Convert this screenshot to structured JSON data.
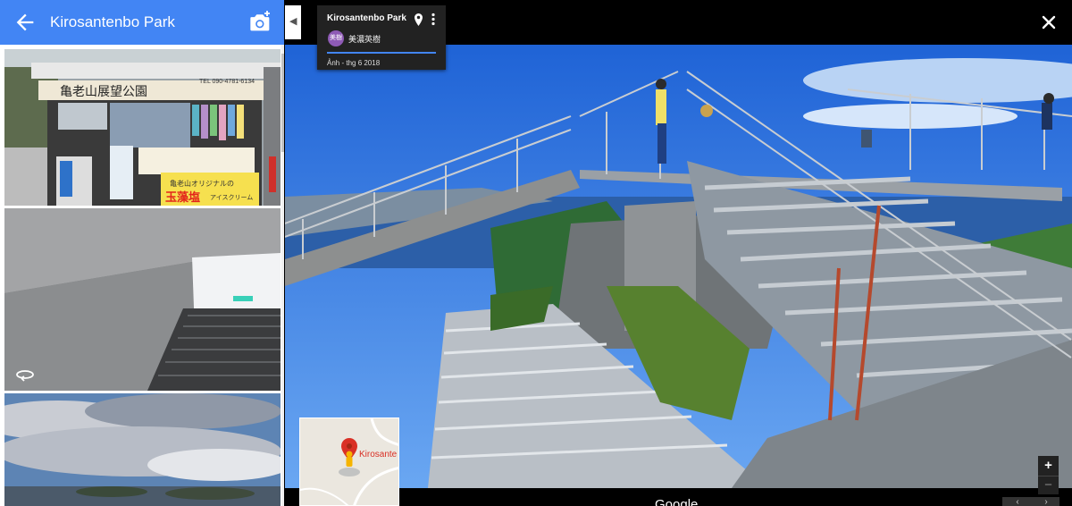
{
  "header": {
    "title": "Kirosantenbo Park",
    "back_icon": "arrow-back-icon",
    "add_photo_icon": "add-photo-camera-icon",
    "color": "#4285f4"
  },
  "thumbnails": [
    {
      "name": "shop-kiosk-photo",
      "sign_text": "亀老山展望公園",
      "phone_text": "TEL 090-4781-6134",
      "banner_text": "亀老山オリジナルの",
      "salt_text": "玉藻塩",
      "cream_text": "アイスクリーム"
    },
    {
      "name": "stairway-tunnel-photo",
      "badge_icon": "panorama-360-icon"
    },
    {
      "name": "cloudy-sky-photo"
    }
  ],
  "info_card": {
    "title": "Kirosantenbo Park",
    "avatar_text": "美樹",
    "author": "美濃英樹",
    "date": "Ảnh - thg 6 2018",
    "pin_icon": "location-pin-icon",
    "more_icon": "more-vert-icon"
  },
  "viewer": {
    "close_icon": "close-icon",
    "collapse_icon": "chevron-left-icon",
    "bottom_label": "Google",
    "zoom_in": "+",
    "zoom_out": "−",
    "prev": "‹",
    "next": "›"
  },
  "minimap": {
    "label": "Kirosante",
    "pin_icon": "map-pin-icon",
    "pegman_icon": "pegman-icon"
  }
}
